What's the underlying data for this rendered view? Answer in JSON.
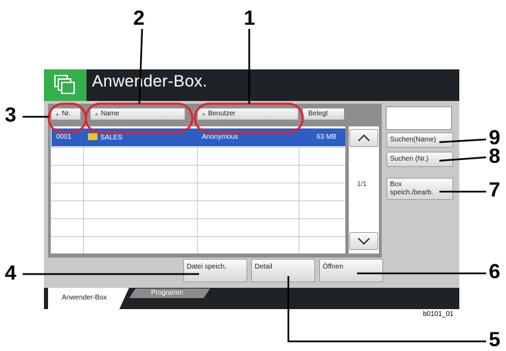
{
  "header": {
    "title": "Anwender-Box.",
    "icon": "box-stack-icon"
  },
  "table": {
    "columns": {
      "nr": "Nr.",
      "name": "Name",
      "user": "Benutzer",
      "used": "Belegt"
    },
    "rows": [
      {
        "nr": "0001",
        "name": "SALES",
        "user": "Anonymous",
        "used": "63 MB",
        "selected": true
      }
    ]
  },
  "pager": {
    "page": "1/1"
  },
  "right_buttons": {
    "search_name": "Suchen(Name)",
    "search_nr": "Suchen (Nr.)",
    "box_edit_line1": "Box",
    "box_edit_line2": "speich./bearb."
  },
  "bottom_buttons": {
    "save_file": "Datei speich.",
    "detail": "Detail",
    "open": "Öffnen"
  },
  "tabs": {
    "active": "Anwender-Box",
    "inactive": "Programm"
  },
  "callouts": [
    "1",
    "2",
    "3",
    "4",
    "5",
    "6",
    "7",
    "8",
    "9"
  ],
  "figure_ref": "b0101_01",
  "colors": {
    "accent": "#34b04a",
    "selection": "#2d5ec4",
    "header_bg": "#1e2328"
  }
}
